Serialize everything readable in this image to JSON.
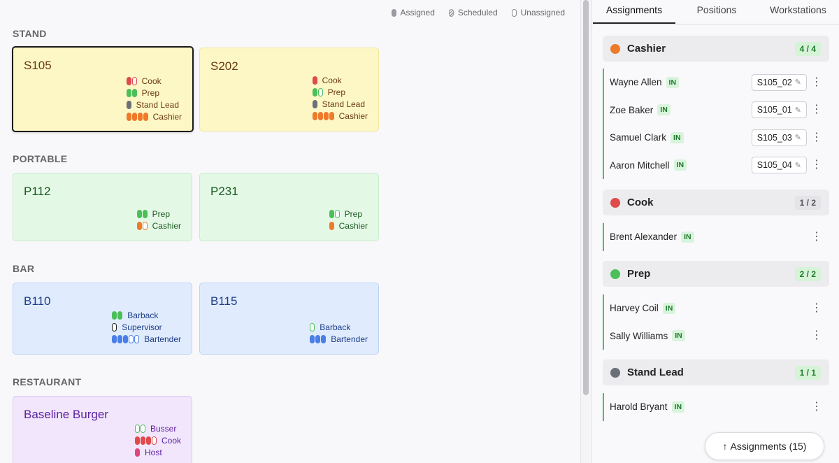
{
  "legend": {
    "assigned": "Assigned",
    "scheduled": "Scheduled",
    "unassigned": "Unassigned"
  },
  "colors": {
    "cook": "#e04a4a",
    "prep": "#4cbf58",
    "stand_lead": "#6b6f78",
    "cashier": "#ee7a2a",
    "barback": "#4cbf58",
    "supervisor": "#222222",
    "bartender": "#4a7fe8",
    "busser": "#4cbf58",
    "host": "#e0457a"
  },
  "sections": {
    "stand": "STAND",
    "portable": "PORTABLE",
    "bar": "BAR",
    "restaurant": "RESTAURANT"
  },
  "cards": {
    "s105": {
      "name": "S105",
      "roles": [
        {
          "label": "Cook",
          "pills": [
            "a",
            "u"
          ],
          "color": "cook"
        },
        {
          "label": "Prep",
          "pills": [
            "a",
            "a"
          ],
          "color": "prep"
        },
        {
          "label": "Stand Lead",
          "pills": [
            "a"
          ],
          "color": "stand_lead"
        },
        {
          "label": "Cashier",
          "pills": [
            "a",
            "a",
            "a",
            "a"
          ],
          "color": "cashier"
        }
      ]
    },
    "s202": {
      "name": "S202",
      "roles": [
        {
          "label": "Cook",
          "pills": [
            "a"
          ],
          "color": "cook"
        },
        {
          "label": "Prep",
          "pills": [
            "a",
            "u"
          ],
          "color": "prep"
        },
        {
          "label": "Stand Lead",
          "pills": [
            "a"
          ],
          "color": "stand_lead"
        },
        {
          "label": "Cashier",
          "pills": [
            "a",
            "a",
            "a",
            "a"
          ],
          "color": "cashier"
        }
      ]
    },
    "p112": {
      "name": "P112",
      "roles": [
        {
          "label": "Prep",
          "pills": [
            "a",
            "a"
          ],
          "color": "prep"
        },
        {
          "label": "Cashier",
          "pills": [
            "a",
            "u"
          ],
          "color": "cashier"
        }
      ]
    },
    "p231": {
      "name": "P231",
      "roles": [
        {
          "label": "Prep",
          "pills": [
            "a",
            "u"
          ],
          "color": "prep"
        },
        {
          "label": "Cashier",
          "pills": [
            "a"
          ],
          "color": "cashier"
        }
      ]
    },
    "b110": {
      "name": "B110",
      "roles": [
        {
          "label": "Barback",
          "pills": [
            "a",
            "a"
          ],
          "color": "barback"
        },
        {
          "label": "Supervisor",
          "pills": [
            "u"
          ],
          "color": "supervisor"
        },
        {
          "label": "Bartender",
          "pills": [
            "a",
            "a",
            "a",
            "u",
            "u"
          ],
          "color": "bartender"
        }
      ]
    },
    "b115": {
      "name": "B115",
      "roles": [
        {
          "label": "Barback",
          "pills": [
            "u"
          ],
          "color": "barback"
        },
        {
          "label": "Bartender",
          "pills": [
            "a",
            "a",
            "a"
          ],
          "color": "bartender"
        }
      ]
    },
    "baseline": {
      "name": "Baseline Burger",
      "roles": [
        {
          "label": "Busser",
          "pills": [
            "u",
            "u"
          ],
          "color": "busser"
        },
        {
          "label": "Cook",
          "pills": [
            "a",
            "a",
            "a",
            "u"
          ],
          "color": "cook"
        },
        {
          "label": "Host",
          "pills": [
            "a"
          ],
          "color": "host"
        }
      ]
    }
  },
  "tabs": [
    "Assignments",
    "Positions",
    "Workstations"
  ],
  "groups": {
    "cashier": {
      "title": "Cashier",
      "count": "4 / 4",
      "dot": "#ee7a2a",
      "people": [
        {
          "name": "Wayne Allen",
          "status": "IN",
          "ws": "S105_02"
        },
        {
          "name": "Zoe Baker",
          "status": "IN",
          "ws": "S105_01"
        },
        {
          "name": "Samuel Clark",
          "status": "IN",
          "ws": "S105_03"
        },
        {
          "name": "Aaron Mitchell",
          "status": "IN",
          "ws": "S105_04"
        }
      ]
    },
    "cook": {
      "title": "Cook",
      "count": "1 / 2",
      "dot": "#e04a4a",
      "people": [
        {
          "name": "Brent Alexander",
          "status": "IN"
        }
      ]
    },
    "prep": {
      "title": "Prep",
      "count": "2 / 2",
      "dot": "#4cbf58",
      "people": [
        {
          "name": "Harvey Coil",
          "status": "IN"
        },
        {
          "name": "Sally Williams",
          "status": "IN"
        }
      ]
    },
    "stand_lead": {
      "title": "Stand Lead",
      "count": "1 / 1",
      "dot": "#6b6f78",
      "people": [
        {
          "name": "Harold Bryant",
          "status": "IN"
        }
      ]
    }
  },
  "footer": {
    "assignments_button": "Assignments (15)",
    "arrow": "↑"
  },
  "icons": {
    "pencil": "✎",
    "kebab": "⋮"
  }
}
